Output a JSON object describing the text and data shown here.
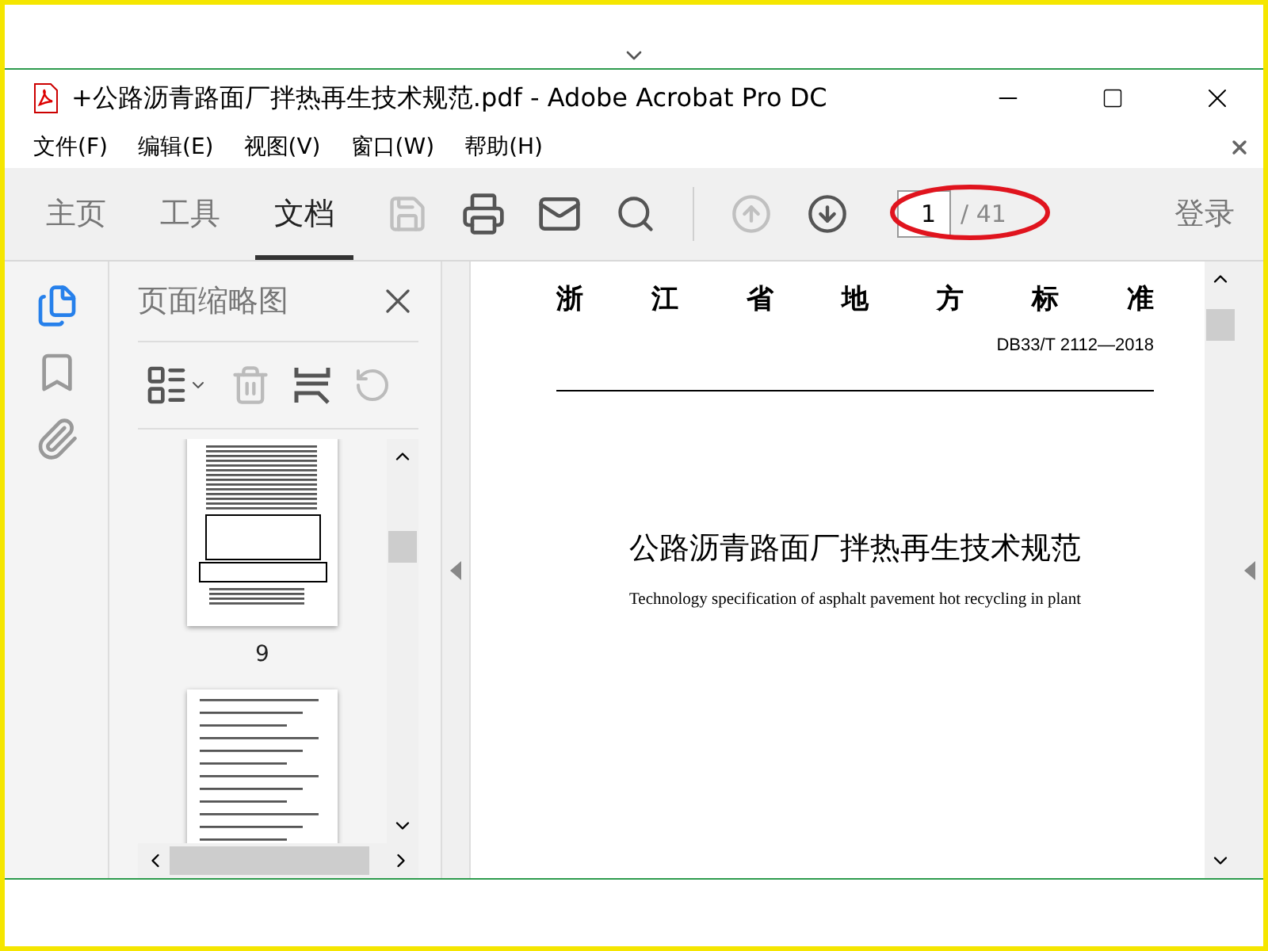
{
  "window": {
    "title": "+公路沥青路面厂拌热再生技术规范.pdf - Adobe Acrobat Pro DC"
  },
  "menu": [
    "文件(F)",
    "编辑(E)",
    "视图(V)",
    "窗口(W)",
    "帮助(H)"
  ],
  "tabs": [
    {
      "label": "主页",
      "selected": false
    },
    {
      "label": "工具",
      "selected": false
    },
    {
      "label": "文档",
      "selected": true
    }
  ],
  "tools": [
    {
      "kind": "save",
      "disabled": true
    },
    {
      "kind": "print",
      "disabled": false
    },
    {
      "kind": "mail",
      "disabled": false
    },
    {
      "kind": "search",
      "disabled": false
    },
    {
      "kind": "prev",
      "disabled": true
    },
    {
      "kind": "next",
      "disabled": false
    }
  ],
  "page_field": {
    "value": "1",
    "total": "/ 41"
  },
  "login": "登录",
  "panel": {
    "title": "页面缩略图",
    "thumbnails": [
      {
        "label": "9",
        "selected": false
      },
      {
        "selected": false
      }
    ]
  },
  "document": {
    "header": [
      "浙",
      "江",
      "省",
      "地",
      "方",
      "标",
      "准"
    ],
    "code": "DB33/T 2112—2018",
    "title": "公路沥青路面厂拌热再生技术规范",
    "subtitle": "Technology specification of asphalt pavement hot recycling in plant"
  }
}
